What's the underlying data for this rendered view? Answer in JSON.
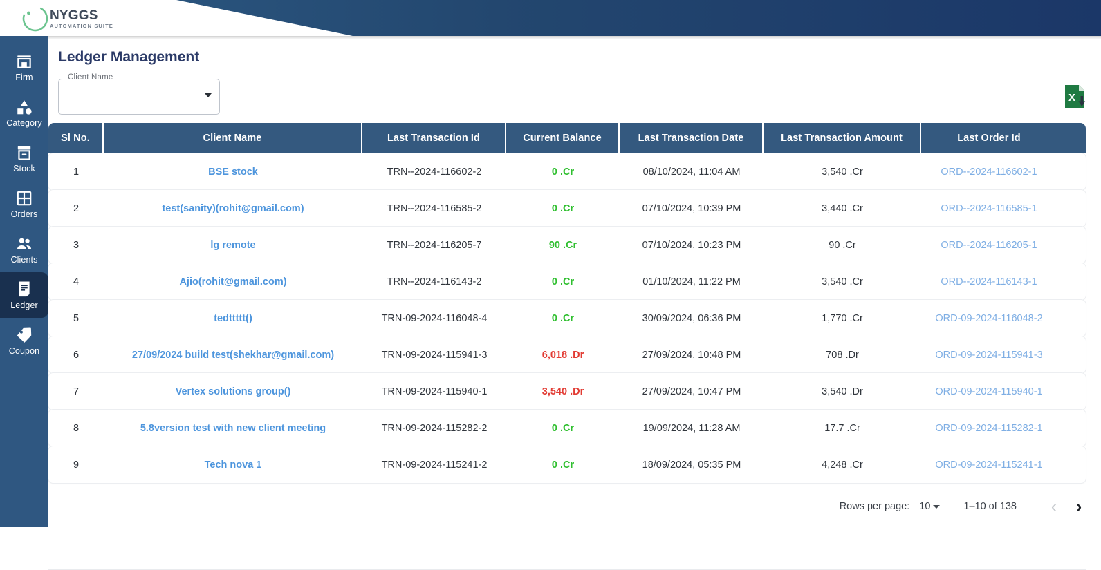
{
  "header": {
    "logo_name": "NYGGS",
    "logo_subtitle": "AUTOMATION SUITE",
    "logo_icon": "nyggs-circle-logo",
    "gradient_start": "#2d5a84",
    "gradient_end": "#1b3768"
  },
  "sidebar": {
    "background": "#2f5781",
    "active_background": "#19304f",
    "items": [
      {
        "label": "Firm",
        "icon": "store-icon",
        "active": false
      },
      {
        "label": "Category",
        "icon": "shapes-icon",
        "active": false
      },
      {
        "label": "Stock",
        "icon": "box-icon",
        "active": false
      },
      {
        "label": "Orders",
        "icon": "grid-icon",
        "active": false
      },
      {
        "label": "Clients",
        "icon": "people-icon",
        "active": false
      },
      {
        "label": "Ledger",
        "icon": "receipt-icon",
        "active": true
      },
      {
        "label": "Coupon",
        "icon": "tag-icon",
        "active": false
      }
    ]
  },
  "main": {
    "page_title": "Ledger Management",
    "title_color": "#2b3a67",
    "filter": {
      "label": "Client Name",
      "value": "",
      "placeholder": "",
      "arrow_icon": "chevron-down-icon"
    },
    "export": {
      "icon": "excel-export-icon",
      "glyph": "X",
      "color": "#1f7a42"
    }
  },
  "table": {
    "header_background": "#34597f",
    "columns": [
      "Sl No.",
      "Client Name",
      "Last Transaction Id",
      "Current Balance",
      "Last Transaction Date",
      "Last Transaction Amount",
      "Last Order Id"
    ],
    "credit_color": "#2fbf2f",
    "debit_color": "#e23c34",
    "link_color": "#4d95dd",
    "rows": [
      {
        "sl_no": "1",
        "client_name": "BSE stock",
        "last_transaction_id": "TRN--2024-116602-2",
        "current_balance": "0 .Cr",
        "balance_type": "cr",
        "last_transaction_date": "08/10/2024, 11:04 AM",
        "last_transaction_amount": "3,540 .Cr",
        "last_order_id": "ORD--2024-116602-1"
      },
      {
        "sl_no": "2",
        "client_name": "test(sanity)(rohit@gmail.com)",
        "last_transaction_id": "TRN--2024-116585-2",
        "current_balance": "0 .Cr",
        "balance_type": "cr",
        "last_transaction_date": "07/10/2024, 10:39 PM",
        "last_transaction_amount": "3,440 .Cr",
        "last_order_id": "ORD--2024-116585-1"
      },
      {
        "sl_no": "3",
        "client_name": "lg remote",
        "last_transaction_id": "TRN--2024-116205-7",
        "current_balance": "90 .Cr",
        "balance_type": "cr",
        "last_transaction_date": "07/10/2024, 10:23 PM",
        "last_transaction_amount": "90 .Cr",
        "last_order_id": "ORD--2024-116205-1"
      },
      {
        "sl_no": "4",
        "client_name": "Ajio(rohit@gmail.com)",
        "last_transaction_id": "TRN--2024-116143-2",
        "current_balance": "0 .Cr",
        "balance_type": "cr",
        "last_transaction_date": "01/10/2024, 11:22 PM",
        "last_transaction_amount": "3,540 .Cr",
        "last_order_id": "ORD--2024-116143-1"
      },
      {
        "sl_no": "5",
        "client_name": "tedttttt()",
        "last_transaction_id": "TRN-09-2024-116048-4",
        "current_balance": "0 .Cr",
        "balance_type": "cr",
        "last_transaction_date": "30/09/2024, 06:36 PM",
        "last_transaction_amount": "1,770 .Cr",
        "last_order_id": "ORD-09-2024-116048-2"
      },
      {
        "sl_no": "6",
        "client_name": "27/09/2024 build test(shekhar@gmail.com)",
        "last_transaction_id": "TRN-09-2024-115941-3",
        "current_balance": "6,018 .Dr",
        "balance_type": "dr",
        "last_transaction_date": "27/09/2024, 10:48 PM",
        "last_transaction_amount": "708 .Dr",
        "last_order_id": "ORD-09-2024-115941-3"
      },
      {
        "sl_no": "7",
        "client_name": "Vertex solutions group()",
        "last_transaction_id": "TRN-09-2024-115940-1",
        "current_balance": "3,540 .Dr",
        "balance_type": "dr",
        "last_transaction_date": "27/09/2024, 10:47 PM",
        "last_transaction_amount": "3,540 .Dr",
        "last_order_id": "ORD-09-2024-115940-1"
      },
      {
        "sl_no": "8",
        "client_name": "5.8version test with new client meeting",
        "last_transaction_id": "TRN-09-2024-115282-2",
        "current_balance": "0 .Cr",
        "balance_type": "cr",
        "last_transaction_date": "19/09/2024, 11:28 AM",
        "last_transaction_amount": "17.7 .Cr",
        "last_order_id": "ORD-09-2024-115282-1"
      },
      {
        "sl_no": "9",
        "client_name": "Tech nova 1",
        "last_transaction_id": "TRN-09-2024-115241-2",
        "current_balance": "0 .Cr",
        "balance_type": "cr",
        "last_transaction_date": "18/09/2024, 05:35 PM",
        "last_transaction_amount": "4,248 .Cr",
        "last_order_id": "ORD-09-2024-115241-1"
      }
    ]
  },
  "pagination": {
    "rows_per_page_label": "Rows per page:",
    "rows_per_page_value": "10",
    "range_label": "1–10 of 138",
    "prev_icon": "chevron-left-icon",
    "next_icon": "chevron-right-icon",
    "prev_glyph": "‹",
    "next_glyph": "›",
    "prev_enabled": false,
    "next_enabled": true
  }
}
